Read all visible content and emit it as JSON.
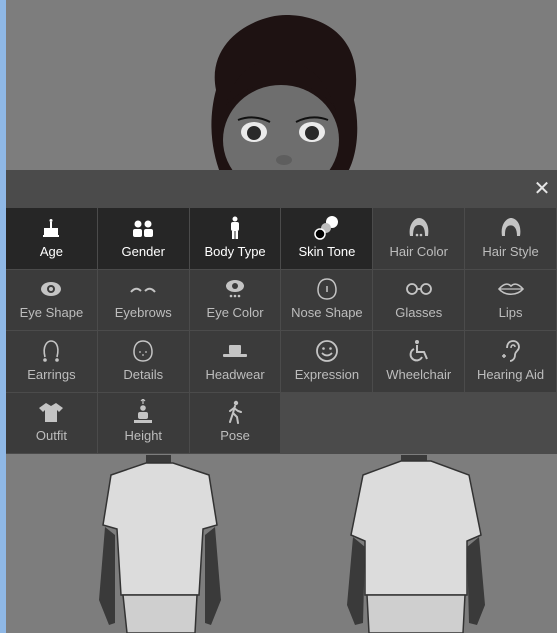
{
  "window": {
    "close_label": "✕"
  },
  "traits": [
    {
      "label": "Age",
      "icon": "cake-icon",
      "selected": true
    },
    {
      "label": "Gender",
      "icon": "people-icon",
      "selected": true
    },
    {
      "label": "Body Type",
      "icon": "body-icon",
      "selected": true
    },
    {
      "label": "Skin Tone",
      "icon": "skin-tone-icon",
      "selected": true
    },
    {
      "label": "Hair Color",
      "icon": "hair-color-icon",
      "selected": false
    },
    {
      "label": "Hair Style",
      "icon": "hair-style-icon",
      "selected": false
    },
    {
      "label": "Eye Shape",
      "icon": "eye-shape-icon",
      "selected": false
    },
    {
      "label": "Eyebrows",
      "icon": "eyebrows-icon",
      "selected": false
    },
    {
      "label": "Eye Color",
      "icon": "eye-color-icon",
      "selected": false
    },
    {
      "label": "Nose Shape",
      "icon": "nose-icon",
      "selected": false
    },
    {
      "label": "Glasses",
      "icon": "glasses-icon",
      "selected": false
    },
    {
      "label": "Lips",
      "icon": "lips-icon",
      "selected": false
    },
    {
      "label": "Earrings",
      "icon": "earrings-icon",
      "selected": false
    },
    {
      "label": "Details",
      "icon": "details-icon",
      "selected": false
    },
    {
      "label": "Headwear",
      "icon": "hat-icon",
      "selected": false
    },
    {
      "label": "Expression",
      "icon": "smile-icon",
      "selected": false
    },
    {
      "label": "Wheelchair",
      "icon": "wheelchair-icon",
      "selected": false
    },
    {
      "label": "Hearing Aid",
      "icon": "hearing-aid-icon",
      "selected": false
    },
    {
      "label": "Outfit",
      "icon": "shirt-icon",
      "selected": false
    },
    {
      "label": "Height",
      "icon": "height-icon",
      "selected": false
    },
    {
      "label": "Pose",
      "icon": "walking-icon",
      "selected": false
    }
  ],
  "colors": {
    "selected_tile": "#262626",
    "tile": "#3b3b3b",
    "panel": "#4b4b4b",
    "backdrop": "#7d7d7d"
  }
}
